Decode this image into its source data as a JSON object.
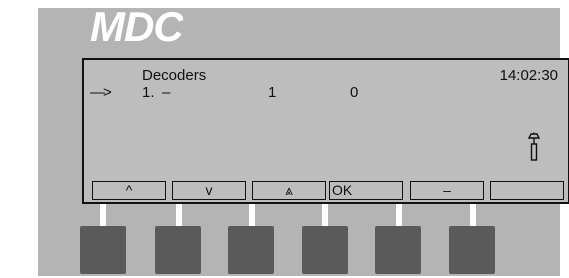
{
  "brand": "MDC",
  "screen": {
    "title": "Decoders",
    "clock": "14:02:30",
    "cursor": "—>",
    "row": {
      "number": "1.",
      "name": "–",
      "value1": "1",
      "value2": "0"
    },
    "lamp_icon": "lamp-icon"
  },
  "softkeys": [
    {
      "label": "^",
      "icon": "up-arrow-icon"
    },
    {
      "label": "v",
      "icon": "down-arrow-icon"
    },
    {
      "label": "⩓",
      "icon": "double-up-arrow-icon"
    },
    {
      "label": "OK",
      "icon": ""
    },
    {
      "label": "–",
      "icon": "minus-icon"
    },
    {
      "label": "",
      "icon": ""
    }
  ],
  "colors": {
    "panel": "#b4b4b4",
    "screen": "#bdbdbd",
    "key": "#5a5a5a",
    "stem": "#ffffff",
    "text": "#111111"
  }
}
